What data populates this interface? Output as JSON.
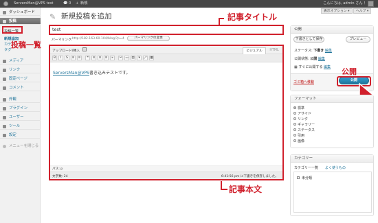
{
  "admin_bar": {
    "site_name": "ServersMan@VPS test",
    "comments_count": "0",
    "new_label": "新規",
    "greeting": "こんにちは, admin さん ！"
  },
  "screen_options": {
    "options_label": "表示オプション ▾",
    "help_label": "ヘルプ ▾"
  },
  "sidebar": {
    "dashboard": "ダッシュボード",
    "posts": "投稿",
    "sub_posts_list": "投稿一覧",
    "sub_new_post": "新規追加",
    "sub_categories": "カテ",
    "sub_tags": "タグ",
    "media": "メディア",
    "links": "リンク",
    "pages": "固定ページ",
    "comments": "コメント",
    "appearance": "外観",
    "plugins": "プラグイン",
    "users": "ユーザー",
    "tools": "ツール",
    "settings": "設定",
    "collapse_menu": "メニューを閉じる"
  },
  "page": {
    "title": "新規投稿を追加"
  },
  "post": {
    "title_value": "test",
    "permalink_label": "パーマリンク:",
    "permalink_url": "http://182.163.60.104/blog/?p=4",
    "permalink_button": "パーマリンクの変更",
    "upload_insert": "アップロード/挿入",
    "tab_visual": "ビジュアル",
    "tab_html": "HTML",
    "body_link": "ServersMan@VPS",
    "body_text": "書き込みテストです。",
    "path_label": "パス: p",
    "word_count": "文字数: 24",
    "draft_saved": "6:41:56 pm に下書きを保存しました。"
  },
  "toolbar": [
    "B",
    "I",
    "S",
    "≡",
    "≡",
    "❝",
    "≡",
    "≡",
    "≡",
    "∞",
    "✂",
    "▭",
    "▤",
    "▾",
    "⤢",
    "▦"
  ],
  "publish_box": {
    "title": "公開",
    "save_draft": "下書きとして保存",
    "preview": "プレビュー",
    "status_label": "ステータス:",
    "status_value": "下書き",
    "edit": "編集",
    "visibility_label": "公開状態:",
    "visibility_value": "公開",
    "schedule_label": "すぐに公開する",
    "trash": "ゴミ箱へ移動",
    "publish_button": "公開"
  },
  "format_box": {
    "title": "フォーマット",
    "options": [
      "標準",
      "アサイド",
      "リンク",
      "ギャラリー",
      "ステータス",
      "引用",
      "画像"
    ],
    "selected": 0
  },
  "category_box": {
    "title": "カテゴリー",
    "tab_all": "カテゴリー一覧",
    "tab_popular": "よく使うもの",
    "item": "未分類"
  },
  "annotations": {
    "title_callout": "記事タイトル",
    "list_callout": "投稿一覧",
    "publish_callout": "公開",
    "body_callout": "記事本文"
  },
  "colors": {
    "accent_red": "#d1202c",
    "link_blue": "#21759b",
    "publish_blue": "#21759b"
  }
}
